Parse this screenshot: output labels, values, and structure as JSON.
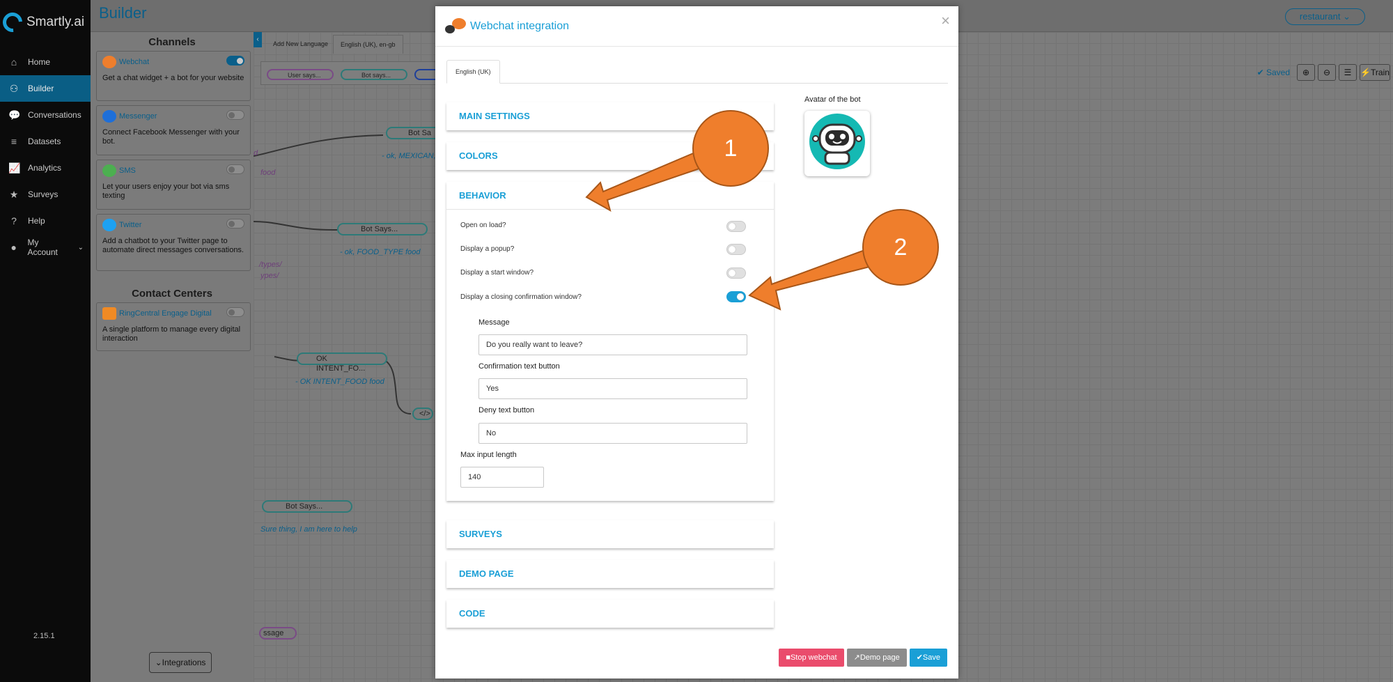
{
  "sidebar": {
    "brand": "Smartly.ai",
    "items": [
      {
        "label": "Home",
        "icon": "home-icon",
        "glyph": "⌂"
      },
      {
        "label": "Builder",
        "icon": "builder-icon",
        "glyph": "⚇"
      },
      {
        "label": "Conversations",
        "icon": "chat-icon",
        "glyph": "💬"
      },
      {
        "label": "Datasets",
        "icon": "database-icon",
        "glyph": "≡"
      },
      {
        "label": "Analytics",
        "icon": "line-chart-icon",
        "glyph": "📈"
      },
      {
        "label": "Surveys",
        "icon": "star-icon",
        "glyph": "★"
      },
      {
        "label": "Help",
        "icon": "help-icon",
        "glyph": "?"
      },
      {
        "label": "My Account",
        "icon": "user-icon",
        "glyph": "●"
      }
    ],
    "version": "2.15.1"
  },
  "header": {
    "title": "Builder",
    "bot_selector": "restaurant"
  },
  "channels": {
    "title": "Channels",
    "items": [
      {
        "name": "Webchat",
        "desc": "Get a chat widget + a bot for your website",
        "enabled": true,
        "color": "#ef7e2c"
      },
      {
        "name": "Messenger",
        "desc": "Connect Facebook Messenger with your bot.",
        "enabled": false,
        "color": "#1e6fd9"
      },
      {
        "name": "SMS",
        "desc": "Let your users enjoy your bot via sms texting",
        "enabled": false,
        "color": "#4caf50"
      },
      {
        "name": "Twitter",
        "desc": "Add a chatbot to your Twitter page to automate direct messages conversations.",
        "enabled": false,
        "color": "#1da1f2"
      }
    ],
    "contact_title": "Contact Centers",
    "contact": [
      {
        "name": "RingCentral Engage Digital",
        "desc": "A single platform to manage every digital interaction",
        "enabled": false,
        "color": "#f08a24"
      }
    ],
    "integrations_button": "Integrations"
  },
  "canvas": {
    "tabs": [
      "Add New Language",
      "English (UK), en-gb"
    ],
    "toolbar_pills": [
      "User says...",
      "Bot says..."
    ],
    "saved": "Saved",
    "train": "Train",
    "nodes": [
      "Bot Sa",
      "Bot Says...",
      "OK INTENT_FO...",
      "Bot Says...",
      "ssage"
    ],
    "texts": [
      "d",
      "food",
      "- ok, MEXICAN,",
      "- ok, FOOD_TYPE food",
      "/types/",
      "ypes/",
      "- OK INTENT_FOOD food",
      "Sure thing, I am here to help"
    ]
  },
  "modal": {
    "title": "Webchat integration",
    "language_tab": "English (UK)",
    "sections": {
      "main": "MAIN SETTINGS",
      "colors": "COLORS",
      "behavior": "BEHAVIOR",
      "surveys": "SURVEYS",
      "demo": "DEMO PAGE",
      "code": "CODE"
    },
    "behavior": {
      "options": [
        {
          "label": "Open on load?",
          "on": false
        },
        {
          "label": "Display a popup?",
          "on": false
        },
        {
          "label": "Display a start window?",
          "on": false
        },
        {
          "label": "Display a closing confirmation window?",
          "on": true
        }
      ],
      "message_label": "Message",
      "message_value": "Do you really want to leave?",
      "confirm_label": "Confirmation text button",
      "confirm_value": "Yes",
      "deny_label": "Deny text button",
      "deny_value": "No",
      "max_label": "Max input length",
      "max_value": "140"
    },
    "avatar_label": "Avatar of the bot",
    "buttons": {
      "stop": "Stop webchat",
      "demo": "Demo page",
      "save": "Save"
    }
  },
  "annotations": {
    "callout_1": "1",
    "callout_2": "2",
    "color": "#ef7e2c"
  }
}
